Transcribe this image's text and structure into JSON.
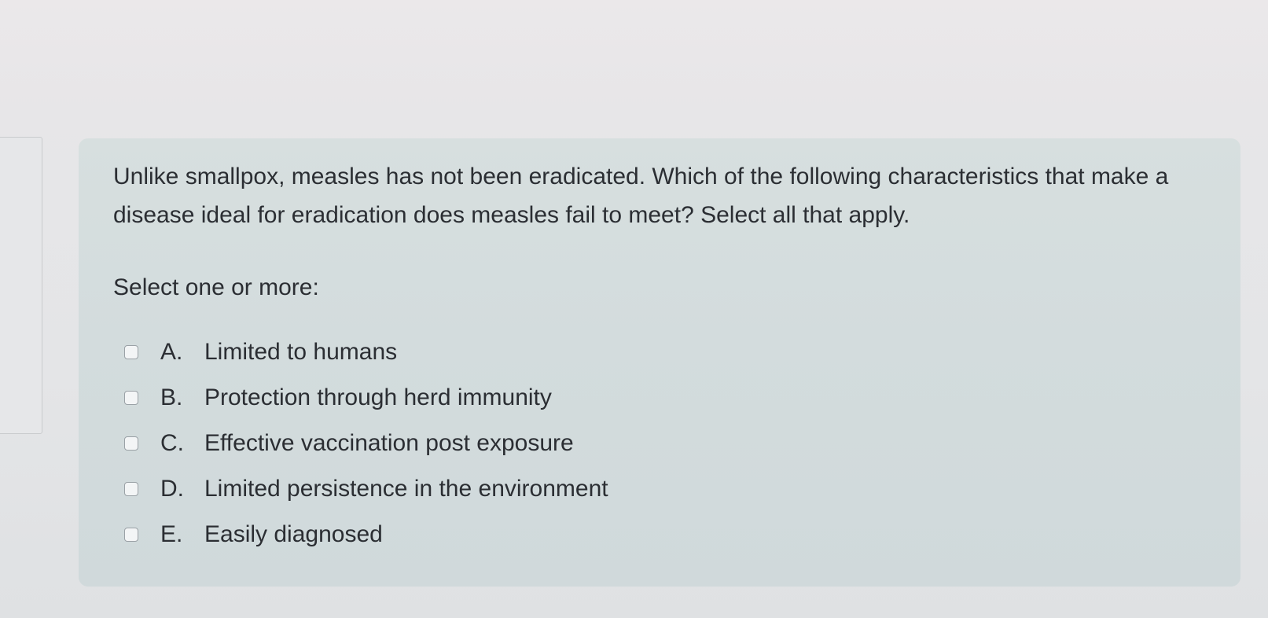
{
  "question": {
    "text": "Unlike smallpox, measles has not been eradicated. Which of the following characteristics that make a disease ideal for eradication does measles fail to meet? Select all that apply.",
    "prompt": "Select one or more:",
    "options": [
      {
        "letter": "A.",
        "label": "Limited to humans",
        "checked": false
      },
      {
        "letter": "B.",
        "label": "Protection through herd immunity",
        "checked": false
      },
      {
        "letter": "C.",
        "label": "Effective vaccination post exposure",
        "checked": false
      },
      {
        "letter": "D.",
        "label": "Limited persistence in the environment",
        "checked": false
      },
      {
        "letter": "E.",
        "label": "Easily diagnosed",
        "checked": false
      }
    ]
  },
  "colors": {
    "card_background": "#d4dcdd",
    "text": "#2b2e33",
    "checkbox_border": "#9aa1a6"
  }
}
